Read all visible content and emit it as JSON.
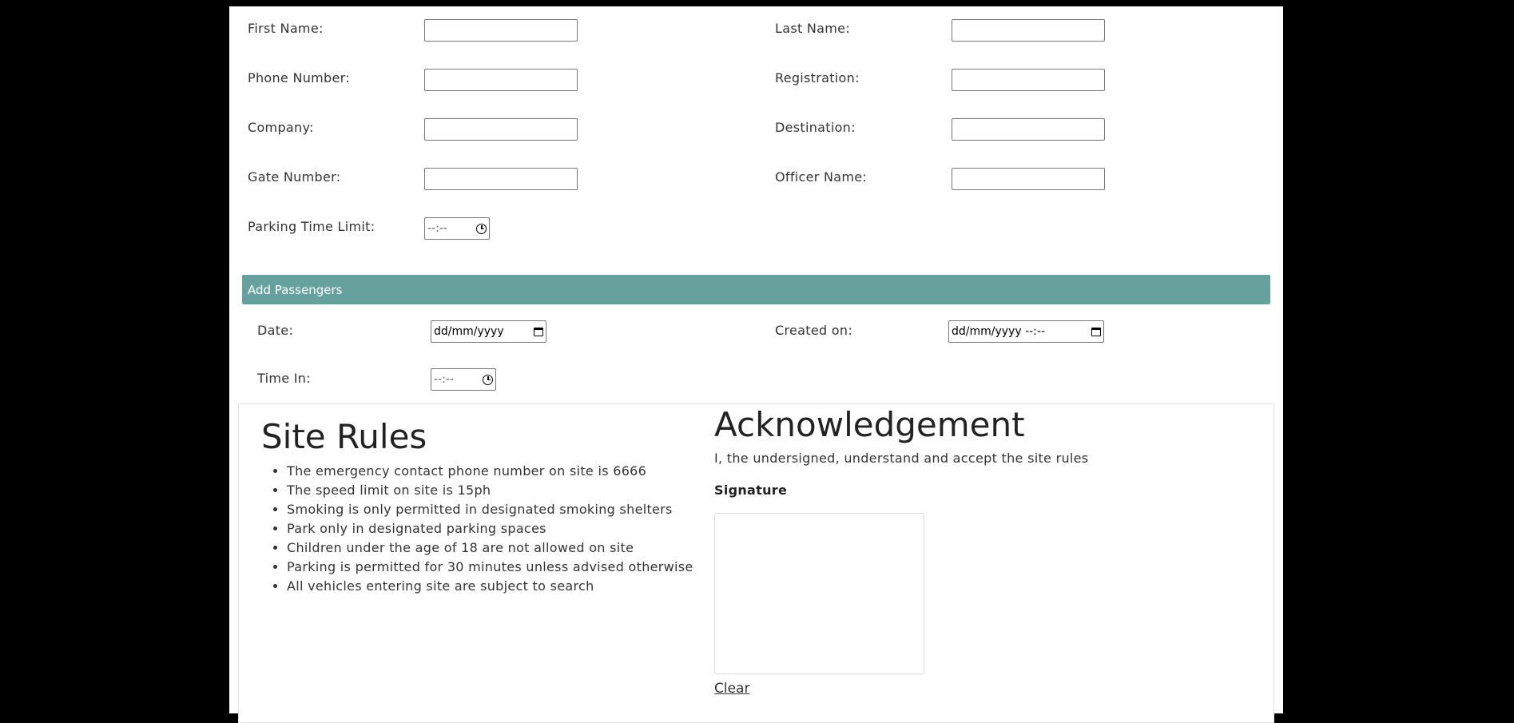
{
  "form": {
    "left": [
      {
        "label": "First Name:",
        "value": ""
      },
      {
        "label": "Phone Number:",
        "value": ""
      },
      {
        "label": "Company:",
        "value": ""
      },
      {
        "label": "Gate Number:",
        "value": ""
      },
      {
        "label": "Parking Time Limit:",
        "value": "--:--"
      }
    ],
    "right": [
      {
        "label": "Last Name:",
        "value": ""
      },
      {
        "label": "Registration:",
        "value": ""
      },
      {
        "label": "Destination:",
        "value": ""
      },
      {
        "label": "Officer Name:",
        "value": ""
      }
    ]
  },
  "passengers": {
    "button_label": "Add Passengers",
    "color": "#66a19d"
  },
  "dates": {
    "date_label": "Date:",
    "date_value": "dd/mm/yyyy",
    "created_label": "Created on:",
    "created_value": "dd/mm/yyyy --:--",
    "time_in_label": "Time In:",
    "time_in_value": "--:--"
  },
  "site_rules": {
    "title": "Site Rules",
    "rules": [
      "The emergency contact phone number on site is 6666",
      "The speed limit on site is 15ph",
      "Smoking is only permitted in designated smoking shelters",
      "Park only in designated parking spaces",
      "Children under the age of 18 are not allowed on site",
      "Parking is permitted for 30 minutes unless advised otherwise",
      "All vehicles entering site are subject to search"
    ]
  },
  "acknowledgement": {
    "title": "Acknowledgement",
    "statement": "I, the undersigned, understand and accept the site rules",
    "signature_label": "Signature",
    "clear_label": "Clear"
  },
  "icons": {
    "time": "clock-icon",
    "date": "calendar-icon"
  }
}
